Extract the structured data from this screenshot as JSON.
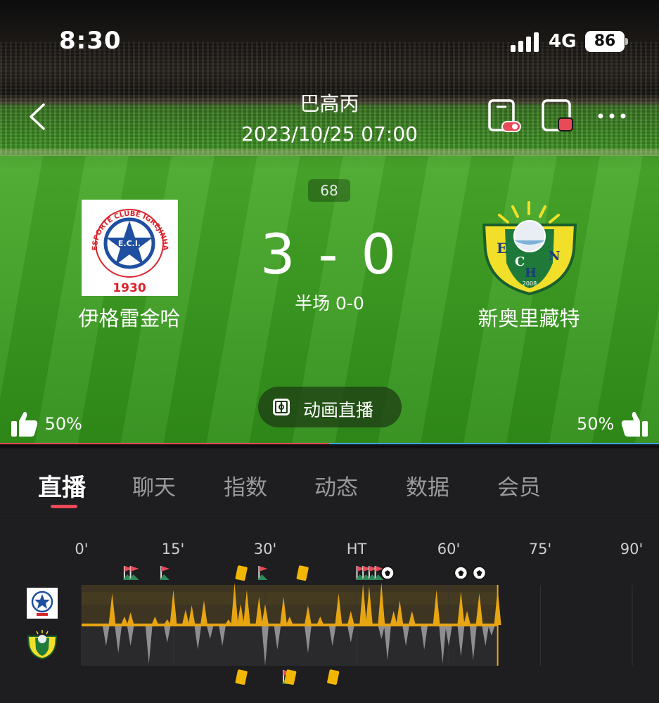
{
  "status": {
    "time": "8:30",
    "network": "4G",
    "battery": "86"
  },
  "header": {
    "league": "巴高丙",
    "datetime": "2023/10/25 07:00"
  },
  "match": {
    "minute": "68",
    "score": "3 - 0",
    "halftime": "半场 0-0",
    "home": {
      "name": "伊格雷金哈",
      "logo_text_top": "ESPORTE CLUBE IGREJINHA",
      "logo_abbr": "E.C.I.",
      "logo_year": "1930"
    },
    "away": {
      "name": "新奥里藏特",
      "logo_letters": [
        "E",
        "C",
        "N",
        "H"
      ],
      "logo_year": "2008"
    }
  },
  "animation_button": {
    "label": "动画直播"
  },
  "support": {
    "home_percent": "50%",
    "away_percent": "50%"
  },
  "tabs": [
    {
      "label": "直播",
      "active": true
    },
    {
      "label": "聊天"
    },
    {
      "label": "指数"
    },
    {
      "label": "动态"
    },
    {
      "label": "数据"
    },
    {
      "label": "会员"
    }
  ],
  "timeline": {
    "ticks": [
      "0'",
      "15'",
      "30'",
      "HT",
      "60'",
      "75'",
      "90'"
    ],
    "current_minute": 68,
    "colors": {
      "home": "#e8a512",
      "away": "#8e8e92",
      "current": "#e8a512"
    },
    "home_events": [
      {
        "type": "corner",
        "minute": 7
      },
      {
        "type": "corner",
        "minute": 8
      },
      {
        "type": "corner",
        "minute": 13
      },
      {
        "type": "yellow-card",
        "minute": 26
      },
      {
        "type": "corner",
        "minute": 29
      },
      {
        "type": "yellow-card",
        "minute": 36
      },
      {
        "type": "corner",
        "minute": 45
      },
      {
        "type": "corner",
        "minute": 46
      },
      {
        "type": "corner",
        "minute": 47
      },
      {
        "type": "corner",
        "minute": 48
      },
      {
        "type": "goal",
        "minute": 50
      },
      {
        "type": "goal",
        "minute": 62
      },
      {
        "type": "goal",
        "minute": 65
      }
    ],
    "away_events": [
      {
        "type": "yellow-card",
        "minute": 26
      },
      {
        "type": "corner",
        "minute": 33
      },
      {
        "type": "yellow-card",
        "minute": 34
      },
      {
        "type": "yellow-card",
        "minute": 41
      }
    ]
  }
}
